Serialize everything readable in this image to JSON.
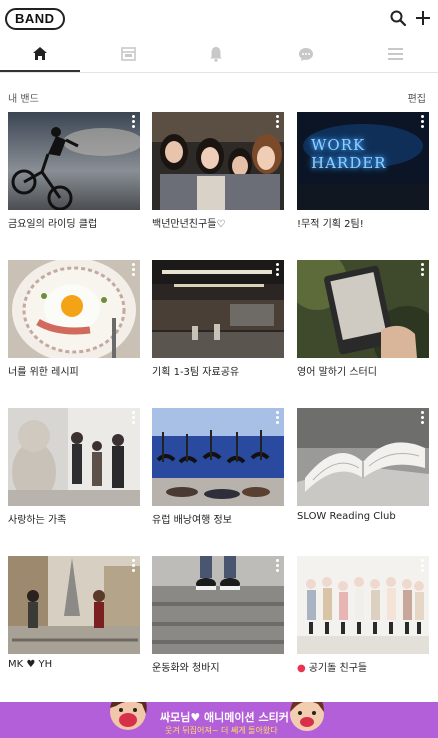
{
  "header": {
    "logo_text": "BAND",
    "search_icon": "search-icon",
    "add_icon": "plus-icon"
  },
  "tabs": [
    {
      "name": "home",
      "icon": "home-icon",
      "active": true
    },
    {
      "name": "feed",
      "icon": "calendar-icon",
      "active": false
    },
    {
      "name": "notifications",
      "icon": "bell-icon",
      "active": false
    },
    {
      "name": "chat",
      "icon": "chat-icon",
      "active": false
    },
    {
      "name": "menu",
      "icon": "menu-icon",
      "active": false
    }
  ],
  "bands_section": {
    "title": "내 밴드",
    "edit_label": "편집"
  },
  "bands": [
    {
      "title": "금요일의 라이딩 클럽"
    },
    {
      "title": "백년만년친구들♡"
    },
    {
      "title": "!무적 기획 2팀!"
    },
    {
      "title": "너를 위한 레시피"
    },
    {
      "title": "기획 1-3팀 자료공유"
    },
    {
      "title": "영어 말하기 스터디"
    },
    {
      "title": "사랑하는 가족"
    },
    {
      "title": "유럽 배낭여행 정보"
    },
    {
      "title": "SLOW Reading Club"
    },
    {
      "title": "MK ♥ YH"
    },
    {
      "title": "운동화와 청바지"
    },
    {
      "title": "공기돌 친구들",
      "has_new": true
    }
  ],
  "thumb_words": {
    "neon_sign": "WORK HARDER"
  },
  "banner": {
    "title": "싸모님♥ 애니메이션 스티커",
    "subtitle": "웃겨 뒤집어져~ 더 쎄게 돌아왔다"
  },
  "colors": {
    "banner_bg": "#b35fd9",
    "new_dot": "#e8344e",
    "neon": "#3fa0ff"
  }
}
